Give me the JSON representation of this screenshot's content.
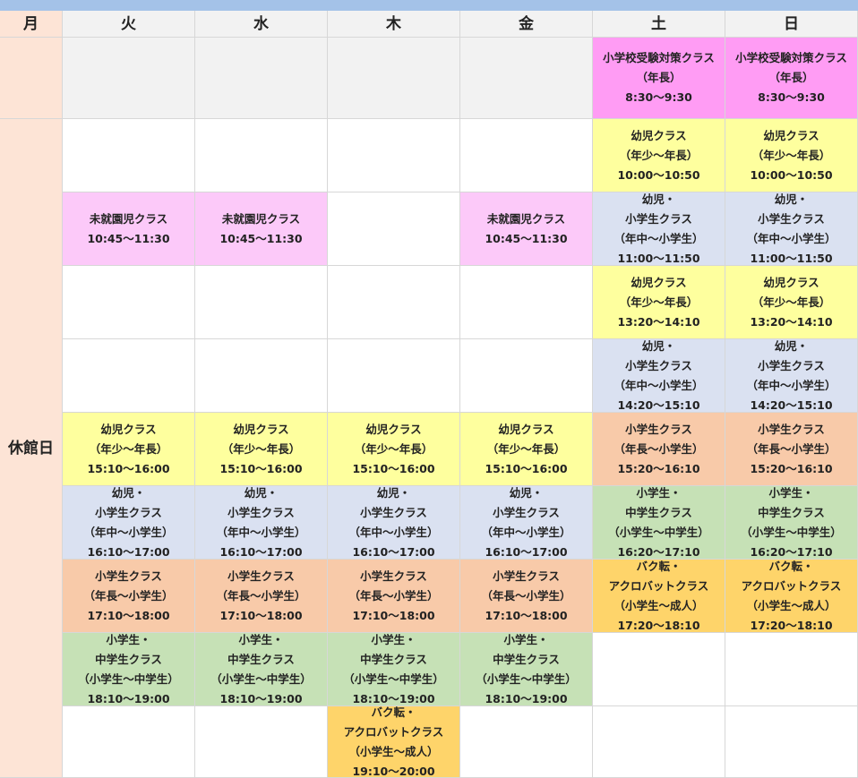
{
  "days": [
    "月",
    "火",
    "水",
    "木",
    "金",
    "土",
    "日"
  ],
  "monday_note": "休館日",
  "colors": {
    "topbar": "#a4c2e8",
    "header": "#f2f2f2",
    "monday_column": "#fde4d6",
    "empty_top": "#f2f2f2",
    "empty": "#ffffff",
    "pink": "#ff9cf4",
    "lightpink": "#fcc9f9",
    "yellow": "#feff9e",
    "blue": "#dae1f1",
    "salmon": "#f8caa9",
    "green": "#c6e1b6",
    "orange": "#fed46a"
  },
  "rows": [
    {
      "cells": [
        {
          "color": "empty_top",
          "lines": []
        },
        {
          "color": "empty_top",
          "lines": []
        },
        {
          "color": "empty_top",
          "lines": []
        },
        {
          "color": "empty_top",
          "lines": []
        },
        {
          "color": "pink",
          "lines": [
            "小学校受験対策クラス",
            "（年長）",
            "8:30～9:30"
          ]
        },
        {
          "color": "pink",
          "lines": [
            "小学校受験対策クラス",
            "（年長）",
            "8:30～9:30"
          ]
        }
      ]
    },
    {
      "cells": [
        {
          "color": "empty",
          "lines": []
        },
        {
          "color": "empty",
          "lines": []
        },
        {
          "color": "empty",
          "lines": []
        },
        {
          "color": "empty",
          "lines": []
        },
        {
          "color": "yellow",
          "lines": [
            "幼児クラス",
            "（年少～年長）",
            "10:00～10:50"
          ]
        },
        {
          "color": "yellow",
          "lines": [
            "幼児クラス",
            "（年少～年長）",
            "10:00～10:50"
          ]
        }
      ]
    },
    {
      "cells": [
        {
          "color": "lightpink",
          "lines": [
            "未就園児クラス",
            "10:45～11:30"
          ]
        },
        {
          "color": "lightpink",
          "lines": [
            "未就園児クラス",
            "10:45～11:30"
          ]
        },
        {
          "color": "empty",
          "lines": []
        },
        {
          "color": "lightpink",
          "lines": [
            "未就園児クラス",
            "10:45～11:30"
          ]
        },
        {
          "color": "blue",
          "lines": [
            "幼児・",
            "小学生クラス",
            "（年中～小学生）",
            "11:00～11:50"
          ]
        },
        {
          "color": "blue",
          "lines": [
            "幼児・",
            "小学生クラス",
            "（年中～小学生）",
            "11:00～11:50"
          ]
        }
      ]
    },
    {
      "cells": [
        {
          "color": "empty",
          "lines": []
        },
        {
          "color": "empty",
          "lines": []
        },
        {
          "color": "empty",
          "lines": []
        },
        {
          "color": "empty",
          "lines": []
        },
        {
          "color": "yellow",
          "lines": [
            "幼児クラス",
            "（年少～年長）",
            "13:20～14:10"
          ]
        },
        {
          "color": "yellow",
          "lines": [
            "幼児クラス",
            "（年少～年長）",
            "13:20～14:10"
          ]
        }
      ]
    },
    {
      "cells": [
        {
          "color": "empty",
          "lines": []
        },
        {
          "color": "empty",
          "lines": []
        },
        {
          "color": "empty",
          "lines": []
        },
        {
          "color": "empty",
          "lines": []
        },
        {
          "color": "blue",
          "lines": [
            "幼児・",
            "小学生クラス",
            "（年中～小学生）",
            "14:20～15:10"
          ]
        },
        {
          "color": "blue",
          "lines": [
            "幼児・",
            "小学生クラス",
            "（年中～小学生）",
            "14:20～15:10"
          ]
        }
      ]
    },
    {
      "cells": [
        {
          "color": "yellow",
          "lines": [
            "幼児クラス",
            "（年少～年長）",
            "15:10～16:00"
          ]
        },
        {
          "color": "yellow",
          "lines": [
            "幼児クラス",
            "（年少～年長）",
            "15:10～16:00"
          ]
        },
        {
          "color": "yellow",
          "lines": [
            "幼児クラス",
            "（年少～年長）",
            "15:10～16:00"
          ]
        },
        {
          "color": "yellow",
          "lines": [
            "幼児クラス",
            "（年少～年長）",
            "15:10～16:00"
          ]
        },
        {
          "color": "salmon",
          "lines": [
            "小学生クラス",
            "（年長～小学生）",
            "15:20～16:10"
          ]
        },
        {
          "color": "salmon",
          "lines": [
            "小学生クラス",
            "（年長～小学生）",
            "15:20～16:10"
          ]
        }
      ]
    },
    {
      "cells": [
        {
          "color": "blue",
          "lines": [
            "幼児・",
            "小学生クラス",
            "（年中～小学生）",
            "16:10～17:00"
          ]
        },
        {
          "color": "blue",
          "lines": [
            "幼児・",
            "小学生クラス",
            "（年中～小学生）",
            "16:10～17:00"
          ]
        },
        {
          "color": "blue",
          "lines": [
            "幼児・",
            "小学生クラス",
            "（年中～小学生）",
            "16:10～17:00"
          ]
        },
        {
          "color": "blue",
          "lines": [
            "幼児・",
            "小学生クラス",
            "（年中～小学生）",
            "16:10～17:00"
          ]
        },
        {
          "color": "green",
          "lines": [
            "小学生・",
            "中学生クラス",
            "（小学生～中学生）",
            "16:20～17:10"
          ]
        },
        {
          "color": "green",
          "lines": [
            "小学生・",
            "中学生クラス",
            "（小学生～中学生）",
            "16:20～17:10"
          ]
        }
      ]
    },
    {
      "cells": [
        {
          "color": "salmon",
          "lines": [
            "小学生クラス",
            "（年長～小学生）",
            "17:10～18:00"
          ]
        },
        {
          "color": "salmon",
          "lines": [
            "小学生クラス",
            "（年長～小学生）",
            "17:10～18:00"
          ]
        },
        {
          "color": "salmon",
          "lines": [
            "小学生クラス",
            "（年長～小学生）",
            "17:10～18:00"
          ]
        },
        {
          "color": "salmon",
          "lines": [
            "小学生クラス",
            "（年長～小学生）",
            "17:10～18:00"
          ]
        },
        {
          "color": "orange",
          "lines": [
            "バク転・",
            "アクロバットクラス",
            "（小学生～成人）",
            "17:20～18:10"
          ]
        },
        {
          "color": "orange",
          "lines": [
            "バク転・",
            "アクロバットクラス",
            "（小学生～成人）",
            "17:20～18:10"
          ]
        }
      ]
    },
    {
      "cells": [
        {
          "color": "green",
          "lines": [
            "小学生・",
            "中学生クラス",
            "（小学生～中学生）",
            "18:10～19:00"
          ]
        },
        {
          "color": "green",
          "lines": [
            "小学生・",
            "中学生クラス",
            "（小学生～中学生）",
            "18:10～19:00"
          ]
        },
        {
          "color": "green",
          "lines": [
            "小学生・",
            "中学生クラス",
            "（小学生～中学生）",
            "18:10～19:00"
          ]
        },
        {
          "color": "green",
          "lines": [
            "小学生・",
            "中学生クラス",
            "（小学生～中学生）",
            "18:10～19:00"
          ]
        },
        {
          "color": "empty",
          "lines": []
        },
        {
          "color": "empty",
          "lines": []
        }
      ]
    },
    {
      "cells": [
        {
          "color": "empty",
          "lines": []
        },
        {
          "color": "empty",
          "lines": []
        },
        {
          "color": "orange",
          "lines": [
            "バク転・",
            "アクロバットクラス",
            "（小学生～成人）",
            "19:10～20:00"
          ]
        },
        {
          "color": "empty",
          "lines": []
        },
        {
          "color": "empty",
          "lines": []
        },
        {
          "color": "empty",
          "lines": []
        }
      ]
    }
  ]
}
